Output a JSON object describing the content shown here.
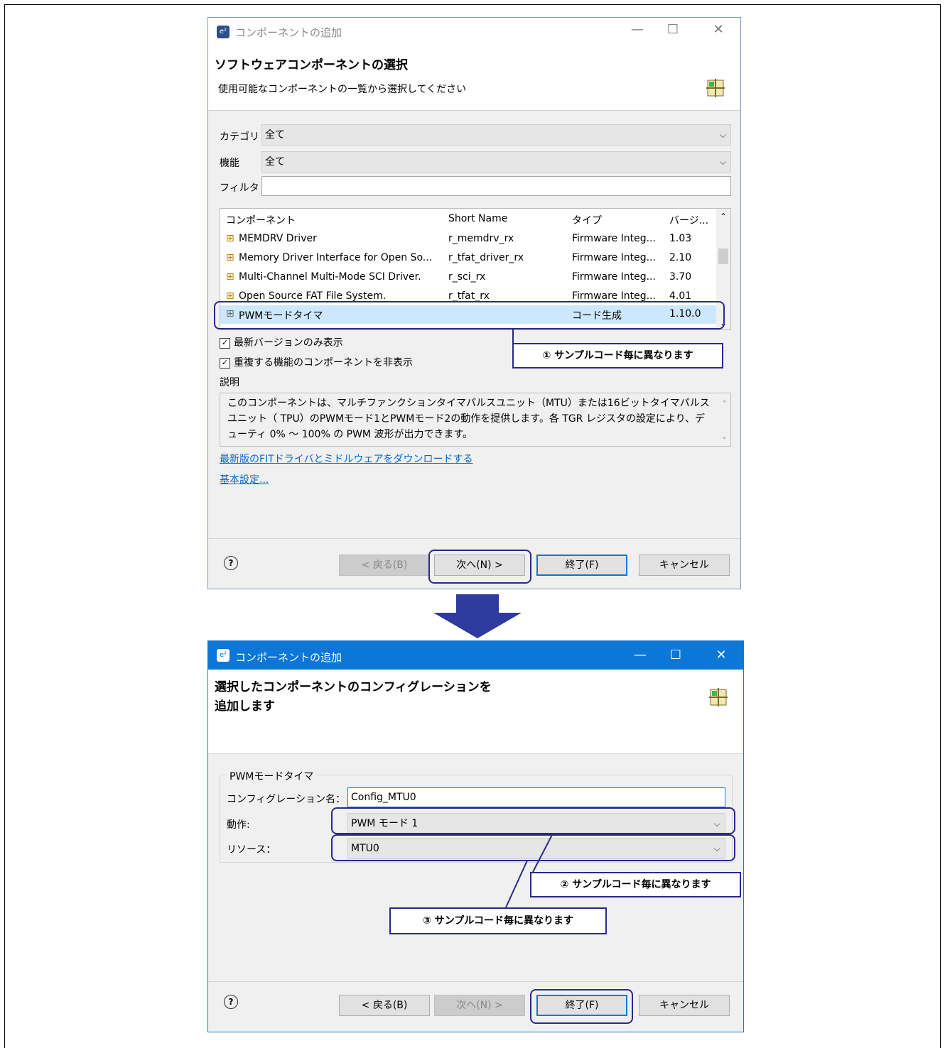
{
  "dialog1": {
    "title": "コンポーネントの追加",
    "header_title": "ソフトウェアコンポーネントの選択",
    "header_subtitle": "使用可能なコンポーネントの一覧から選択してください",
    "category_label": "カテゴリ",
    "category_value": "全て",
    "function_label": "機能",
    "function_value": "全て",
    "filter_label": "フィルタ",
    "filter_value": "",
    "table": {
      "headers": [
        "コンポーネント",
        "Short Name",
        "タイプ",
        "バージ..."
      ],
      "rows": [
        {
          "name": "MEMDRV Driver",
          "short": "r_memdrv_rx",
          "type": "Firmware Integ...",
          "version": "1.03"
        },
        {
          "name": "Memory Driver Interface for Open So...",
          "short": "r_tfat_driver_rx",
          "type": "Firmware Integ...",
          "version": "2.10"
        },
        {
          "name": "Multi-Channel Multi-Mode SCI Driver.",
          "short": "r_sci_rx",
          "type": "Firmware Integ...",
          "version": "3.70"
        },
        {
          "name": "Open Source FAT File System.",
          "short": "r_tfat_rx",
          "type": "Firmware Integ...",
          "version": "4.01"
        },
        {
          "name": "PWMモードタイマ",
          "short": "",
          "type": "コード生成",
          "version": "1.10.0"
        }
      ]
    },
    "check_latest": "最新バージョンのみ表示",
    "check_hide_dup": "重複する機能のコンポーネントを非表示",
    "desc_label": "説明",
    "description": "このコンポーネントは、マルチファンクションタイマパルスユニット（MTU）または16ビットタイマパルスユニット（ TPU）のPWMモード1とPWMモード2の動作を提供します。各 TGR レジスタの設定により、デューティ 0% ～ 100% の PWM 波形が出力できます。",
    "link_download": "最新版のFITドライバとミドルウェアをダウンロードする",
    "link_basic": "基本設定...",
    "btn_back": "< 戻る(B)",
    "btn_next": "次へ(N) >",
    "btn_finish": "終了(F)",
    "btn_cancel": "キャンセル"
  },
  "dialog2": {
    "title": "コンポーネントの追加",
    "header_title": "選択したコンポーネントのコンフィグレーションを追加します",
    "group_title": "PWMモードタイマ",
    "config_name_label": "コンフィグレーション名：",
    "config_name_value": "Config_MTU0",
    "operation_label": "動作:",
    "operation_value": "PWM モード 1",
    "resource_label": "リソース：",
    "resource_value": "MTU0",
    "btn_back": "< 戻る(B)",
    "btn_next": "次へ(N) >",
    "btn_finish": "終了(F)",
    "btn_cancel": "キャンセル"
  },
  "callouts": {
    "c1": "① サンプルコード毎に異なります",
    "c2": "② サンプルコード毎に異なります",
    "c3": "③ サンプルコード毎に異なります"
  },
  "colors": {
    "accent": "#0c77d6",
    "annotation": "#2a2a8a",
    "arrow": "#2e3a9e",
    "selection": "#cce8ff",
    "link": "#0066cc"
  },
  "icons": [
    "app-icon",
    "component-icon",
    "help-icon",
    "chevron-down-icon",
    "checkbox-icon",
    "arrow-down-icon"
  ]
}
